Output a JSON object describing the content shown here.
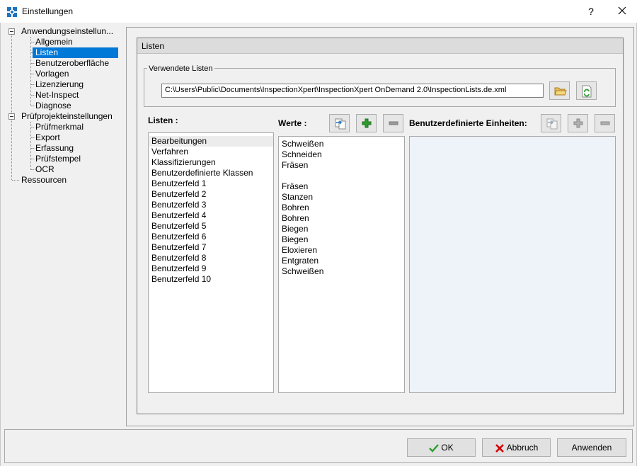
{
  "window": {
    "title": "Einstellungen",
    "help": "?"
  },
  "tree": {
    "app_settings": "Anwendungseinstellun...",
    "app_children": [
      "Allgemein",
      "Listen",
      "Benutzeroberfläche",
      "Vorlagen",
      "Lizenzierung",
      "Net-Inspect",
      "Diagnose"
    ],
    "project_settings": "Prüfprojekteinstellungen",
    "project_children": [
      "Prüfmerkmal",
      "Export",
      "Erfassung",
      "Prüfstempel",
      "OCR"
    ],
    "resources": "Ressourcen",
    "selected": "Listen"
  },
  "panel": {
    "header": "Listen",
    "used_lists_label": "Verwendete Listen",
    "path_value": "C:\\Users\\Public\\Documents\\InspectionXpert\\InspectionXpert OnDemand 2.0\\InspectionLists.de.xml"
  },
  "lists": {
    "label": "Listen :",
    "items": [
      "Bearbeitungen",
      "Verfahren",
      "Klassifizierungen",
      "Benutzerdefinierte Klassen",
      "Benutzerfeld 1",
      "Benutzerfeld 2",
      "Benutzerfeld 3",
      "Benutzerfeld 4",
      "Benutzerfeld 5",
      "Benutzerfeld 6",
      "Benutzerfeld 7",
      "Benutzerfeld 8",
      "Benutzerfeld 9",
      "Benutzerfeld 10"
    ]
  },
  "values": {
    "label": "Werte :",
    "items": [
      "Schweißen",
      "Schneiden",
      "Fräsen",
      "",
      "Fräsen",
      "Stanzen",
      "Bohren",
      "Bohren",
      "Biegen",
      "Biegen",
      "Eloxieren",
      "Entgraten",
      "Schweißen"
    ]
  },
  "units": {
    "label": "Benutzerdefinierte Einheiten:"
  },
  "buttons": {
    "ok": "OK",
    "cancel": "Abbruch",
    "apply": "Anwenden"
  },
  "colors": {
    "selection": "#0078d7",
    "add_green": "#2e9e2e",
    "cancel_red": "#d40000",
    "units_bg": "#eef3fa"
  }
}
